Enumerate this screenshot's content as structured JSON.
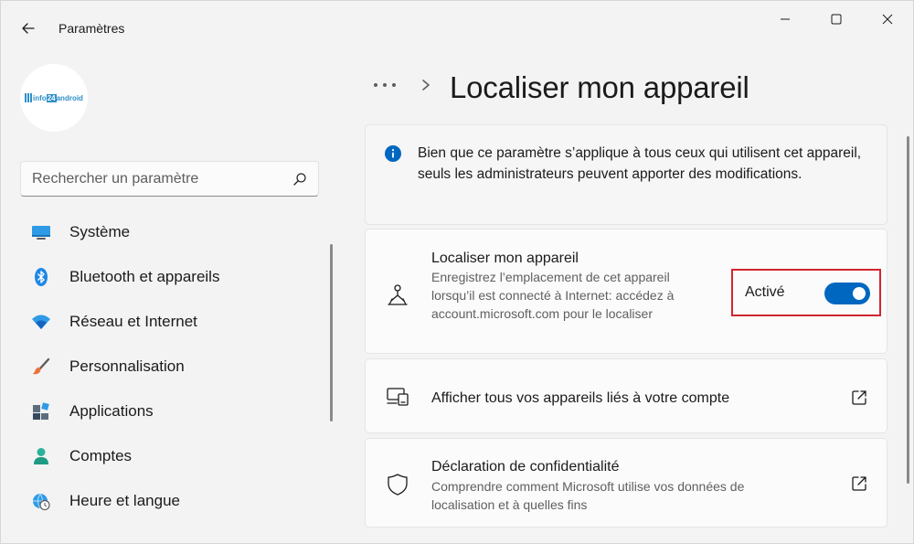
{
  "window": {
    "title": "Paramètres"
  },
  "sidebar": {
    "avatar_logo": "info24android",
    "search": {
      "placeholder": "Rechercher un paramètre",
      "value": ""
    },
    "items": [
      {
        "label": "Système",
        "icon": "monitor-icon"
      },
      {
        "label": "Bluetooth et appareils",
        "icon": "bluetooth-icon"
      },
      {
        "label": "Réseau et Internet",
        "icon": "wifi-icon"
      },
      {
        "label": "Personnalisation",
        "icon": "brush-icon"
      },
      {
        "label": "Applications",
        "icon": "apps-icon"
      },
      {
        "label": "Comptes",
        "icon": "person-icon"
      },
      {
        "label": "Heure et langue",
        "icon": "clock-globe-icon"
      }
    ]
  },
  "breadcrumb": {
    "more": "•••",
    "title": "Localiser mon appareil"
  },
  "info_card": {
    "text": "Bien que ce paramètre s’applique à tous ceux qui utilisent cet appareil, seuls les administrateurs peuvent apporter des modifications."
  },
  "locate_card": {
    "title": "Localiser mon appareil",
    "description": "Enregistrez l’emplacement de cet appareil lorsqu’il est connecté à Internet: accédez à account.microsoft.com pour le localiser",
    "toggle_label": "Activé",
    "toggle_on": true
  },
  "linked_card": {
    "title": "Afficher tous vos appareils liés à votre compte"
  },
  "privacy_card": {
    "title": "Déclaration de confidentialité",
    "description": "Comprendre comment Microsoft utilise vos données de localisation et à quelles fins"
  },
  "colors": {
    "accent": "#0067c0",
    "highlight_border": "#d0262f",
    "background": "#f3f3f3",
    "card": "#fbfbfb"
  }
}
